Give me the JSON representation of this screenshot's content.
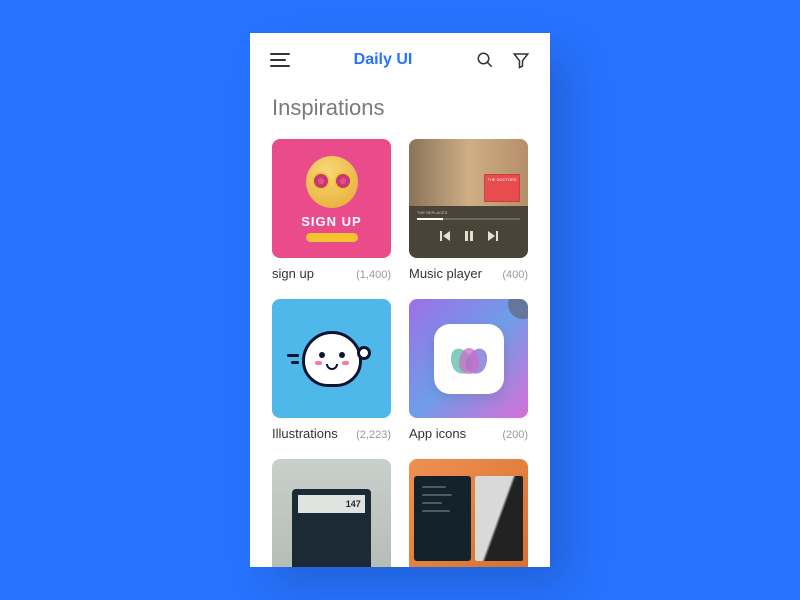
{
  "header": {
    "title": "Daily UI"
  },
  "section_title": "Inspirations",
  "cards": [
    {
      "label": "sign up",
      "count": "(1,400)",
      "overlay_text": "SIGN UP",
      "album_text": "THE DOCTORS"
    },
    {
      "label": "Music player",
      "count": "(400)",
      "track": "THE REPLACES"
    },
    {
      "label": "Illustrations",
      "count": "(2,223)"
    },
    {
      "label": "App icons",
      "count": "(200)"
    },
    {
      "display": "147"
    }
  ]
}
